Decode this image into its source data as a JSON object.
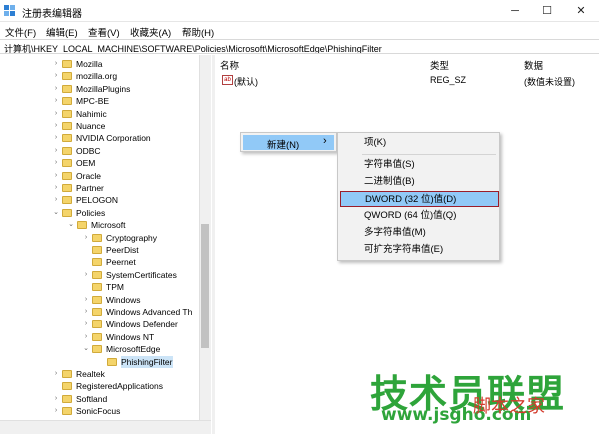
{
  "window": {
    "title": "注册表编辑器",
    "minimize": "─",
    "maximize": "☐",
    "close": "✕"
  },
  "menubar": [
    "文件(F)",
    "编辑(E)",
    "查看(V)",
    "收藏夹(A)",
    "帮助(H)"
  ],
  "address": "计算机\\HKEY_LOCAL_MACHINE\\SOFTWARE\\Policies\\Microsoft\\MicrosoftEdge\\PhishingFilter",
  "tree": [
    {
      "label": "Mozilla",
      "depth": 0,
      "expander": "›"
    },
    {
      "label": "mozilla.org",
      "depth": 0,
      "expander": "›"
    },
    {
      "label": "MozillaPlugins",
      "depth": 0,
      "expander": "›"
    },
    {
      "label": "MPC-BE",
      "depth": 0,
      "expander": "›"
    },
    {
      "label": "Nahimic",
      "depth": 0,
      "expander": "›"
    },
    {
      "label": "Nuance",
      "depth": 0,
      "expander": "›"
    },
    {
      "label": "NVIDIA Corporation",
      "depth": 0,
      "expander": "›"
    },
    {
      "label": "ODBC",
      "depth": 0,
      "expander": "›"
    },
    {
      "label": "OEM",
      "depth": 0,
      "expander": "›"
    },
    {
      "label": "Oracle",
      "depth": 0,
      "expander": "›"
    },
    {
      "label": "Partner",
      "depth": 0,
      "expander": "›"
    },
    {
      "label": "PELOGON",
      "depth": 0,
      "expander": "›"
    },
    {
      "label": "Policies",
      "depth": 0,
      "expander": "⌄"
    },
    {
      "label": "Microsoft",
      "depth": 1,
      "expander": "⌄"
    },
    {
      "label": "Cryptography",
      "depth": 2,
      "expander": "›"
    },
    {
      "label": "PeerDist",
      "depth": 2,
      "expander": ""
    },
    {
      "label": "Peernet",
      "depth": 2,
      "expander": ""
    },
    {
      "label": "SystemCertificates",
      "depth": 2,
      "expander": "›"
    },
    {
      "label": "TPM",
      "depth": 2,
      "expander": ""
    },
    {
      "label": "Windows",
      "depth": 2,
      "expander": "›"
    },
    {
      "label": "Windows Advanced Th",
      "depth": 2,
      "expander": "›"
    },
    {
      "label": "Windows Defender",
      "depth": 2,
      "expander": "›"
    },
    {
      "label": "Windows NT",
      "depth": 2,
      "expander": "›"
    },
    {
      "label": "MicrosoftEdge",
      "depth": 2,
      "expander": "⌄"
    },
    {
      "label": "PhishingFilter",
      "depth": 3,
      "expander": "",
      "selected": true
    },
    {
      "label": "Realtek",
      "depth": 0,
      "expander": "›"
    },
    {
      "label": "RegisteredApplications",
      "depth": 0,
      "expander": ""
    },
    {
      "label": "Softland",
      "depth": 0,
      "expander": "›"
    },
    {
      "label": "SonicFocus",
      "depth": 0,
      "expander": "›"
    }
  ],
  "list": {
    "headers": {
      "name": "名称",
      "type": "类型",
      "data": "数据"
    },
    "rows": [
      {
        "icon": "ab",
        "name": "(默认)",
        "type": "REG_SZ",
        "data": "(数值未设置)"
      }
    ]
  },
  "context_menu": {
    "item": "新建(N)",
    "arrow": "›"
  },
  "submenu": [
    {
      "label": "项(K)",
      "highlight": false
    },
    {
      "label": "字符串值(S)",
      "highlight": false
    },
    {
      "label": "二进制值(B)",
      "highlight": false
    },
    {
      "label": "DWORD (32 位)值(D)",
      "highlight": true
    },
    {
      "label": "QWORD (64 位)值(Q)",
      "highlight": false
    },
    {
      "label": "多字符串值(M)",
      "highlight": false
    },
    {
      "label": "可扩充字符串值(E)",
      "highlight": false
    }
  ],
  "watermark": {
    "title": "技术员联盟",
    "url": "www.jsgho.com",
    "brand": "脚本之家"
  },
  "colors": {
    "highlight": "#91c9f7",
    "highlight_border": "#9b1d2a",
    "watermark_green": "#2ea43a",
    "folder": "#f4d46a"
  }
}
